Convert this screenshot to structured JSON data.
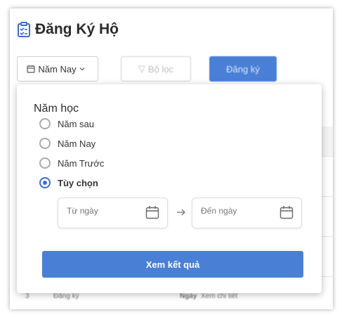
{
  "page": {
    "title": "Đăng Ký Hộ"
  },
  "toolbar": {
    "year_label": "Năm Nay",
    "filter_label": "Bộ lọc",
    "register_label": "Đăng ký"
  },
  "background_row": {
    "col1": "Đăng ký",
    "col2": "Ngày",
    "col3": "Xem chi tiết"
  },
  "popup": {
    "section_label": "Năm học",
    "options": [
      {
        "label": "Năm sau",
        "selected": false
      },
      {
        "label": "Năm Nay",
        "selected": false
      },
      {
        "label": "Năm Trước",
        "selected": false
      },
      {
        "label": "Tùy chọn",
        "selected": true
      }
    ],
    "from_placeholder": "Từ ngày",
    "to_placeholder": "Đến ngày",
    "submit_label": "Xem kết quả"
  },
  "colors": {
    "accent": "#4a7fd6"
  }
}
